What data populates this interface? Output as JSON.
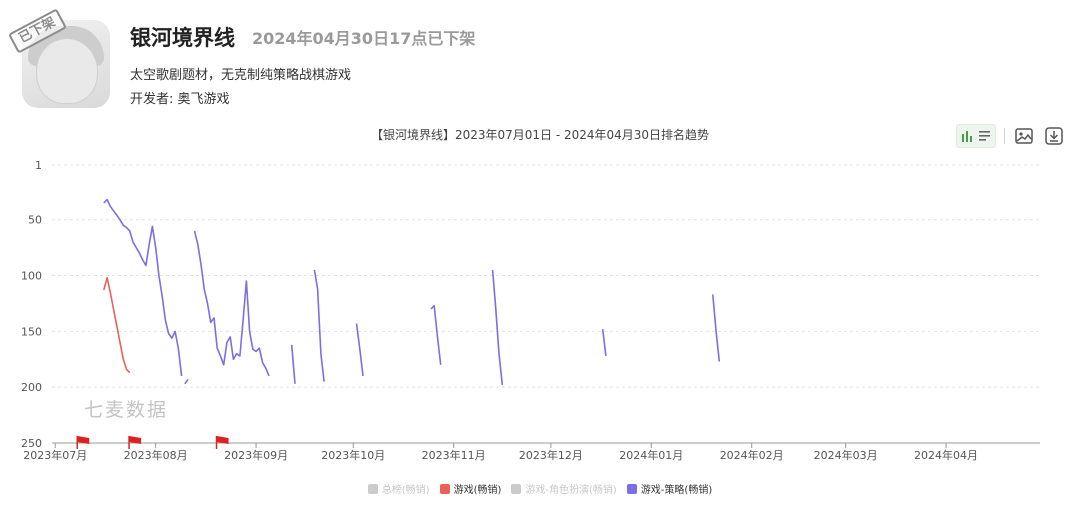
{
  "app": {
    "title": "银河境界线",
    "status": "2024年04月30日17点已下架",
    "stamp": "已下架",
    "description": "太空歌剧题材，无克制纯策略战棋游戏",
    "developer": "开发者: 奥飞游戏"
  },
  "watermark": "七麦数据",
  "toolbar": {
    "chart_icon": "bar-chart-icon",
    "list_icon": "list-icon",
    "image_icon": "image-icon",
    "download_icon": "download-icon",
    "accent": "#43a047"
  },
  "chart_data": {
    "type": "line",
    "title": "【银河境界线】2023年07月01日 - 2024年04月30日排名趋势",
    "y_inverted": true,
    "ylim": [
      1,
      250
    ],
    "y_ticks": [
      "1",
      "50",
      "100",
      "150",
      "200",
      "250"
    ],
    "y_tick_values": [
      1,
      50,
      100,
      150,
      200,
      250
    ],
    "x_ticks": [
      "2023年07月",
      "2023年08月",
      "2023年09月",
      "2023年10月",
      "2023年11月",
      "2023年12月",
      "2024年01月",
      "2024年02月",
      "2024年03月",
      "2024年04月"
    ],
    "x_tick_dates": [
      "2023-07-01",
      "2023-08-01",
      "2023-09-01",
      "2023-10-01",
      "2023-11-01",
      "2023-12-01",
      "2024-01-01",
      "2024-02-01",
      "2024-03-01",
      "2024-04-01"
    ],
    "x_range": [
      "2023-06-30",
      "2024-04-30"
    ],
    "grid": true,
    "legend_position": "bottom",
    "series": [
      {
        "name": "总榜(畅销)",
        "color": "#cccccc",
        "active": false,
        "segments": []
      },
      {
        "name": "游戏(畅销)",
        "color": "#e8625b",
        "active": true,
        "segments": [
          [
            [
              "2023-07-16",
              113
            ],
            [
              "2023-07-17",
              102
            ],
            [
              "2023-07-18",
              115
            ],
            [
              "2023-07-19",
              130
            ],
            [
              "2023-07-20",
              145
            ],
            [
              "2023-07-21",
              160
            ],
            [
              "2023-07-22",
              175
            ],
            [
              "2023-07-23",
              184
            ],
            [
              "2023-07-24",
              187
            ]
          ]
        ]
      },
      {
        "name": "游戏-角色扮演(畅销)",
        "color": "#cccccc",
        "active": false,
        "segments": []
      },
      {
        "name": "游戏-策略(畅销)",
        "color": "#7b6ee6",
        "active": true,
        "segments": [
          [
            [
              "2023-07-16",
              35
            ],
            [
              "2023-07-17",
              32
            ],
            [
              "2023-07-18",
              38
            ],
            [
              "2023-07-19",
              42
            ],
            [
              "2023-07-20",
              46
            ],
            [
              "2023-07-21",
              50
            ],
            [
              "2023-07-22",
              55
            ],
            [
              "2023-07-23",
              57
            ],
            [
              "2023-07-24",
              60
            ],
            [
              "2023-07-25",
              70
            ],
            [
              "2023-07-26",
              75
            ],
            [
              "2023-07-27",
              80
            ],
            [
              "2023-07-28",
              86
            ],
            [
              "2023-07-29",
              91
            ],
            [
              "2023-07-30",
              72
            ],
            [
              "2023-07-31",
              56
            ],
            [
              "2023-08-01",
              75
            ],
            [
              "2023-08-02",
              100
            ],
            [
              "2023-08-03",
              118
            ],
            [
              "2023-08-04",
              140
            ],
            [
              "2023-08-05",
              152
            ],
            [
              "2023-08-06",
              156
            ],
            [
              "2023-08-07",
              150
            ],
            [
              "2023-08-08",
              165
            ],
            [
              "2023-08-09",
              190
            ]
          ],
          [
            [
              "2023-08-10",
              197
            ],
            [
              "2023-08-11",
              193
            ]
          ],
          [
            [
              "2023-08-13",
              60
            ],
            [
              "2023-08-14",
              72
            ],
            [
              "2023-08-15",
              90
            ],
            [
              "2023-08-16",
              112
            ],
            [
              "2023-08-17",
              125
            ],
            [
              "2023-08-18",
              142
            ],
            [
              "2023-08-19",
              138
            ],
            [
              "2023-08-20",
              165
            ],
            [
              "2023-08-21",
              172
            ],
            [
              "2023-08-22",
              180
            ],
            [
              "2023-08-23",
              160
            ],
            [
              "2023-08-24",
              155
            ],
            [
              "2023-08-25",
              175
            ],
            [
              "2023-08-26",
              170
            ],
            [
              "2023-08-27",
              172
            ],
            [
              "2023-08-28",
              140
            ],
            [
              "2023-08-29",
              105
            ],
            [
              "2023-08-30",
              150
            ],
            [
              "2023-08-31",
              166
            ],
            [
              "2023-09-01",
              168
            ],
            [
              "2023-09-02",
              165
            ],
            [
              "2023-09-03",
              178
            ],
            [
              "2023-09-04",
              183
            ],
            [
              "2023-09-05",
              190
            ]
          ],
          [
            [
              "2023-09-12",
              162
            ],
            [
              "2023-09-13",
              197
            ]
          ],
          [
            [
              "2023-09-19",
              95
            ],
            [
              "2023-09-20",
              112
            ],
            [
              "2023-09-21",
              170
            ],
            [
              "2023-09-22",
              195
            ]
          ],
          [
            [
              "2023-10-02",
              143
            ],
            [
              "2023-10-03",
              165
            ],
            [
              "2023-10-04",
              190
            ]
          ],
          [
            [
              "2023-10-25",
              130
            ],
            [
              "2023-10-26",
              127
            ],
            [
              "2023-10-27",
              155
            ],
            [
              "2023-10-28",
              180
            ]
          ],
          [
            [
              "2023-11-13",
              95
            ],
            [
              "2023-11-14",
              130
            ],
            [
              "2023-11-15",
              170
            ],
            [
              "2023-11-16",
              198
            ]
          ],
          [
            [
              "2023-12-17",
              148
            ],
            [
              "2023-12-18",
              172
            ]
          ],
          [
            [
              "2024-01-20",
              117
            ],
            [
              "2024-01-21",
              150
            ],
            [
              "2024-01-22",
              177
            ]
          ]
        ]
      }
    ],
    "event_flags": [
      "2023-07-01",
      "2023-07-17",
      "2023-08-13"
    ],
    "flag_color": "#e02020"
  }
}
